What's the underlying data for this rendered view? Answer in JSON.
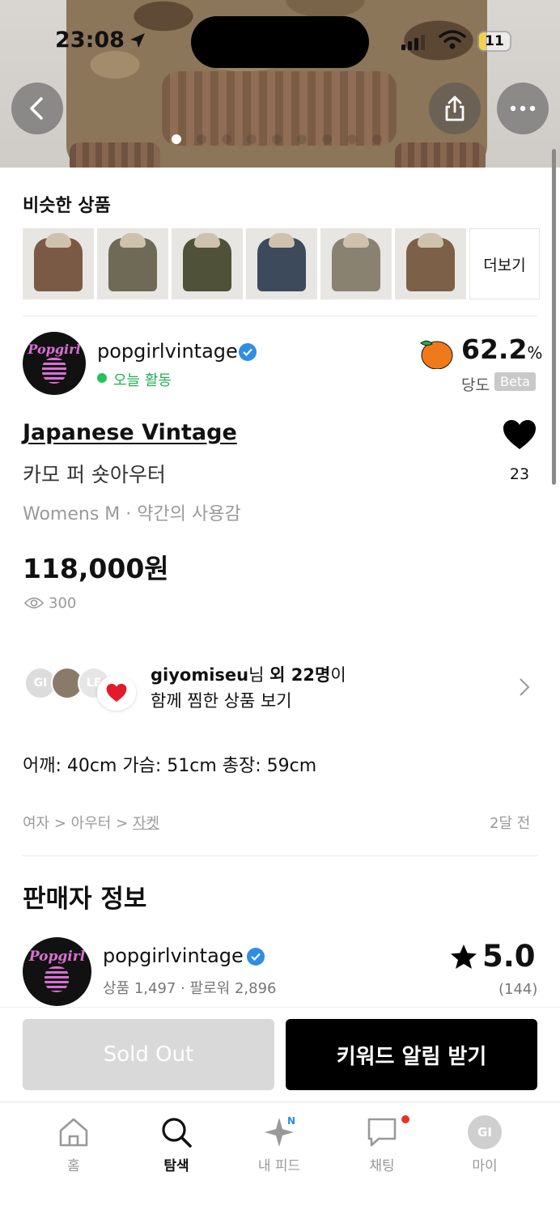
{
  "status_bar": {
    "time": "23:08",
    "battery": "11"
  },
  "hero": {
    "page_count": 9,
    "active_index": 0
  },
  "similar": {
    "title": "비슷한 상품",
    "more_label": "더보기",
    "thumb_colors": [
      "#7b5a45",
      "#6e6a55",
      "#4f5138",
      "#3d4a5c",
      "#8a8270",
      "#7d6048"
    ]
  },
  "seller": {
    "name": "popgirlvintage",
    "activity": "오늘 활동",
    "peach_percent": "62.2",
    "percent_sign": "%",
    "peach_label": "당도",
    "beta": "Beta",
    "avatar_text": "Popgirl"
  },
  "product": {
    "brand": "Japanese Vintage",
    "title": "카모 퍼 숏아우터",
    "meta": "Womens M · 약간의 사용감",
    "price": "118,000원",
    "views": "300",
    "likes": "23"
  },
  "liked_together": {
    "avatar_initials": [
      "GI",
      "LE"
    ],
    "user": "giyomiseu",
    "suffix_nim": "님",
    "others": "외 22명",
    "suffix_i": "이",
    "line2": "함께 찜한 상품 보기"
  },
  "measurements": "어깨: 40cm 가슴: 51cm  총장: 59cm",
  "category": {
    "lvl1": "여자",
    "lvl2": "아우터",
    "lvl3": "자켓",
    "sep": " > ",
    "posted": "2달 전"
  },
  "seller_info": {
    "title": "판매자 정보",
    "name": "popgirlvintage",
    "stats": "상품 1,497 · 팔로워 2,896",
    "rating": "5.0",
    "rating_count": "(144)"
  },
  "cta": {
    "sold_out": "Sold Out",
    "keyword_alert": "키워드 알림 받기"
  },
  "tabs": [
    {
      "label": "홈",
      "icon": "home-icon"
    },
    {
      "label": "탐색",
      "icon": "search-icon",
      "active": true
    },
    {
      "label": "내 피드",
      "icon": "sparkle-icon",
      "badge": "N"
    },
    {
      "label": "채팅",
      "icon": "chat-icon"
    },
    {
      "label": "마이",
      "icon": "profile-icon",
      "initials": "GI"
    }
  ],
  "colors": {
    "verified": "#2f8de4",
    "active_green": "#21b055",
    "peach": "#f07a1a",
    "alert_red": "#e6312a"
  }
}
